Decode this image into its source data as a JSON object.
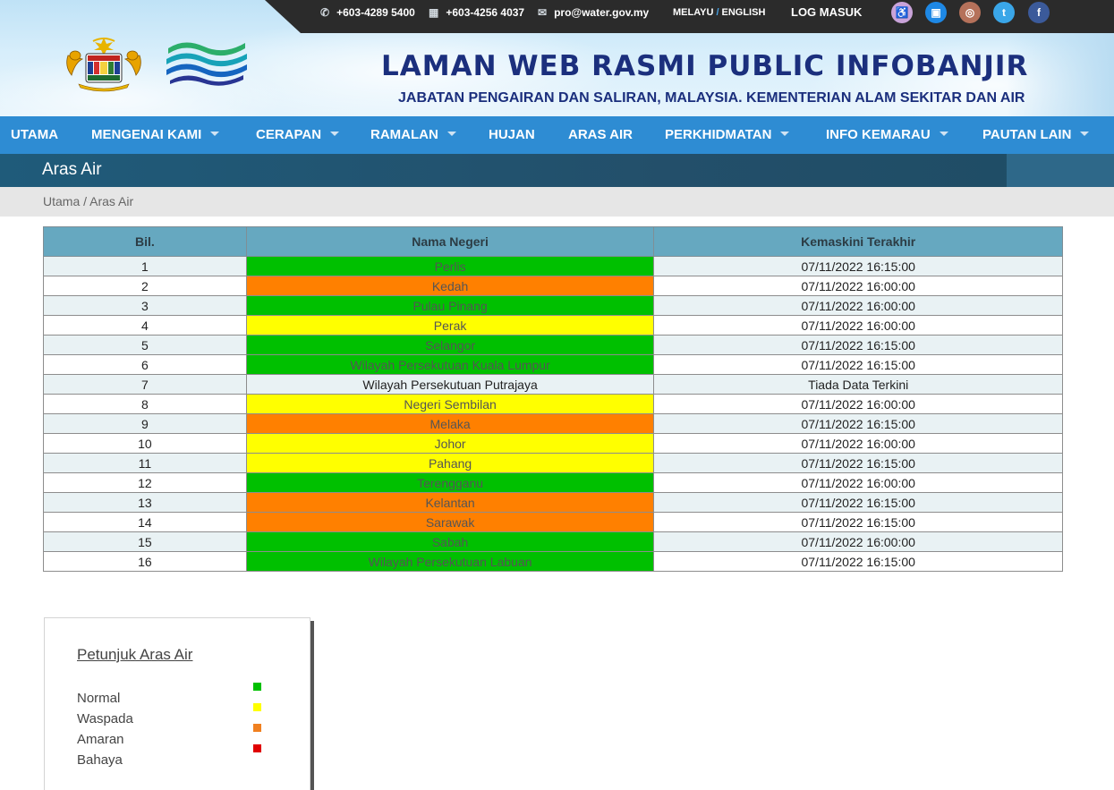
{
  "topbar": {
    "phone": "+603-4289 5400",
    "fax": "+603-4256 4037",
    "email": "pro@water.gov.my",
    "lang_melayu": "MELAYU",
    "lang_sep": "/",
    "lang_english": "ENGLISH",
    "login": "LOG MASUK",
    "social": [
      {
        "name": "accessibility-icon",
        "glyph": "♿",
        "color": "#c9a3d9"
      },
      {
        "name": "book-icon",
        "glyph": "▣",
        "color": "#1e88e5"
      },
      {
        "name": "instagram-icon",
        "glyph": "◎",
        "color": "#b5715a"
      },
      {
        "name": "twitter-icon",
        "glyph": "t",
        "color": "#3aa6e8"
      },
      {
        "name": "facebook-icon",
        "glyph": "f",
        "color": "#3b5a9a"
      }
    ]
  },
  "header": {
    "title": "LAMAN WEB RASMI PUBLIC INFOBANJIR",
    "subtitle": "JABATAN PENGAIRAN DAN SALIRAN, MALAYSIA. KEMENTERIAN ALAM SEKITAR DAN AIR"
  },
  "nav": {
    "items": [
      {
        "label": "UTAMA",
        "dropdown": false
      },
      {
        "label": "MENGENAI KAMI",
        "dropdown": true
      },
      {
        "label": "CERAPAN",
        "dropdown": true
      },
      {
        "label": "RAMALAN",
        "dropdown": true
      },
      {
        "label": "HUJAN",
        "dropdown": false
      },
      {
        "label": "ARAS AIR",
        "dropdown": false
      },
      {
        "label": "PERKHIDMATAN",
        "dropdown": true
      },
      {
        "label": "INFO KEMARAU",
        "dropdown": true
      },
      {
        "label": "PAUTAN LAIN",
        "dropdown": true
      }
    ]
  },
  "page": {
    "heading": "Aras Air",
    "breadcrumb": "Utama / Aras Air"
  },
  "table": {
    "headers": [
      "Bil.",
      "Nama Negeri",
      "Kemaskini Terakhir"
    ],
    "rows": [
      {
        "no": "1",
        "state": "Perlis",
        "updated": "07/11/2022 16:15:00",
        "status": "green"
      },
      {
        "no": "2",
        "state": "Kedah",
        "updated": "07/11/2022 16:00:00",
        "status": "orange"
      },
      {
        "no": "3",
        "state": "Pulau Pinang",
        "updated": "07/11/2022 16:00:00",
        "status": "green"
      },
      {
        "no": "4",
        "state": "Perak",
        "updated": "07/11/2022 16:00:00",
        "status": "yellow"
      },
      {
        "no": "5",
        "state": "Selangor",
        "updated": "07/11/2022 16:15:00",
        "status": "green"
      },
      {
        "no": "6",
        "state": "Wilayah Persekutuan Kuala Lumpur",
        "updated": "07/11/2022 16:15:00",
        "status": "green"
      },
      {
        "no": "7",
        "state": "Wilayah Persekutuan Putrajaya",
        "updated": "Tiada Data Terkini",
        "status": "none"
      },
      {
        "no": "8",
        "state": "Negeri Sembilan",
        "updated": "07/11/2022 16:00:00",
        "status": "yellow"
      },
      {
        "no": "9",
        "state": "Melaka",
        "updated": "07/11/2022 16:15:00",
        "status": "orange"
      },
      {
        "no": "10",
        "state": "Johor",
        "updated": "07/11/2022 16:00:00",
        "status": "yellow"
      },
      {
        "no": "11",
        "state": "Pahang",
        "updated": "07/11/2022 16:15:00",
        "status": "yellow"
      },
      {
        "no": "12",
        "state": "Terengganu",
        "updated": "07/11/2022 16:00:00",
        "status": "green"
      },
      {
        "no": "13",
        "state": "Kelantan",
        "updated": "07/11/2022 16:15:00",
        "status": "orange"
      },
      {
        "no": "14",
        "state": "Sarawak",
        "updated": "07/11/2022 16:15:00",
        "status": "orange"
      },
      {
        "no": "15",
        "state": "Sabah",
        "updated": "07/11/2022 16:00:00",
        "status": "green"
      },
      {
        "no": "16",
        "state": "Wilayah Persekutuan Labuan",
        "updated": "07/11/2022 16:15:00",
        "status": "green"
      }
    ]
  },
  "legend": {
    "title": "Petunjuk Aras Air",
    "items": [
      {
        "label": "Normal",
        "color": "#00c000"
      },
      {
        "label": "Waspada",
        "color": "#ffff00"
      },
      {
        "label": "Amaran",
        "color": "#f08020"
      },
      {
        "label": "Bahaya",
        "color": "#e00000"
      }
    ]
  }
}
